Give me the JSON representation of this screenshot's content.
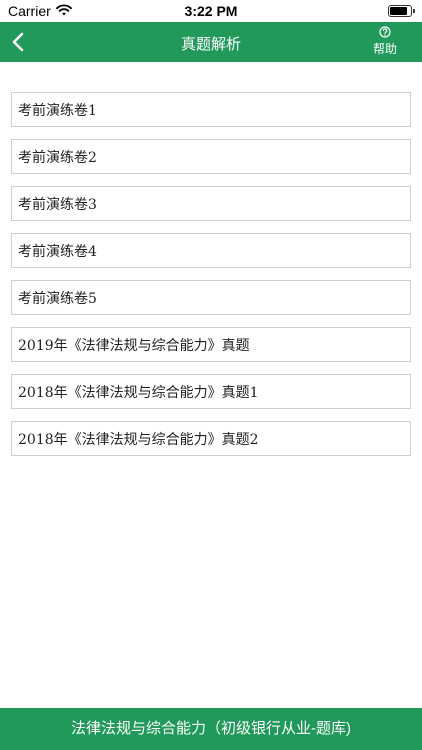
{
  "status_bar": {
    "carrier": "Carrier",
    "time": "3:22 PM",
    "battery_level": 0.85
  },
  "nav": {
    "title": "真题解析",
    "back_icon": "chevron-left-icon",
    "help_icon": "question-circle-icon",
    "help_label": "帮助"
  },
  "exams": [
    "考前演练卷1",
    "考前演练卷2",
    "考前演练卷3",
    "考前演练卷4",
    "考前演练卷5",
    "2019年《法律法规与综合能力》真题",
    "2018年《法律法规与综合能力》真题1",
    "2018年《法律法规与综合能力》真题2"
  ],
  "footer": {
    "label": "法律法规与综合能力（初级银行从业-题库)"
  },
  "colors": {
    "brand_green": "#20995a",
    "item_border": "#cfcfcf"
  }
}
